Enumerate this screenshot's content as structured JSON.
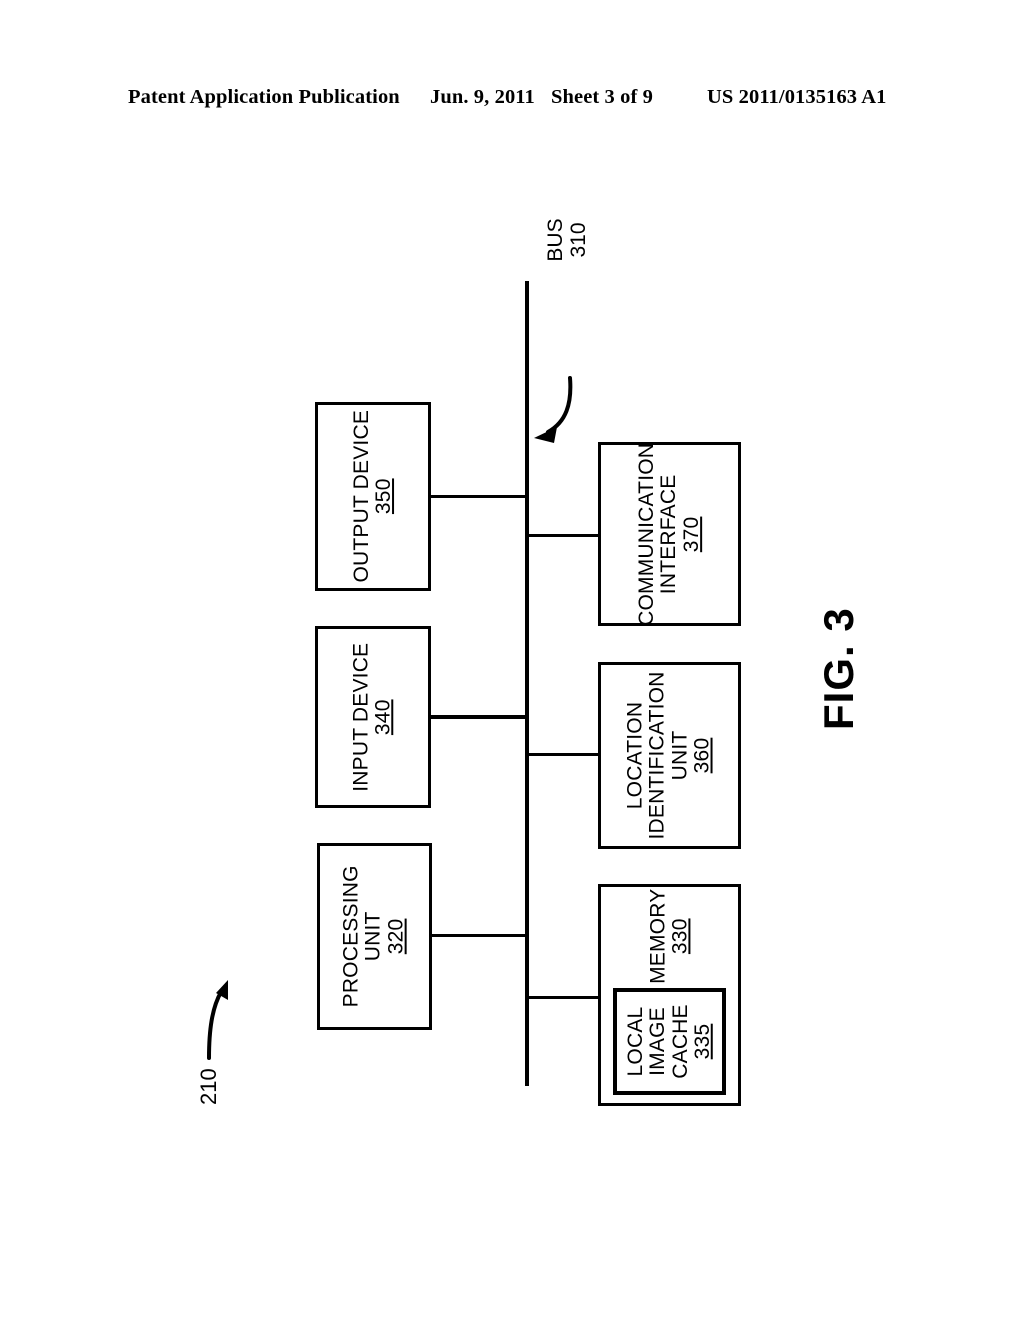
{
  "header": {
    "publication": "Patent Application Publication",
    "date": "Jun. 9, 2011",
    "sheet": "Sheet 3 of 9",
    "document_number": "US 2011/0135163 A1"
  },
  "figure": {
    "label": "FIG. 3",
    "system_ref": "210",
    "bus": {
      "name": "BUS",
      "ref": "310"
    },
    "blocks": [
      {
        "id": "output-device",
        "lines": [
          "OUTPUT DEVICE"
        ],
        "ref": "350"
      },
      {
        "id": "input-device",
        "lines": [
          "INPUT DEVICE"
        ],
        "ref": "340"
      },
      {
        "id": "processing-unit",
        "lines": [
          "PROCESSING",
          "UNIT"
        ],
        "ref": "320"
      },
      {
        "id": "communication-interface",
        "lines": [
          "COMMUNICATION",
          "INTERFACE"
        ],
        "ref": "370"
      },
      {
        "id": "location-identification-unit",
        "lines": [
          "LOCATION",
          "IDENTIFICATION",
          "UNIT"
        ],
        "ref": "360"
      },
      {
        "id": "memory",
        "lines": [
          "MEMORY"
        ],
        "ref": "330"
      },
      {
        "id": "local-image-cache",
        "lines": [
          "LOCAL",
          "IMAGE",
          "CACHE"
        ],
        "ref": "335"
      }
    ]
  },
  "colors": {
    "ink": "#000000",
    "paper": "#ffffff"
  }
}
